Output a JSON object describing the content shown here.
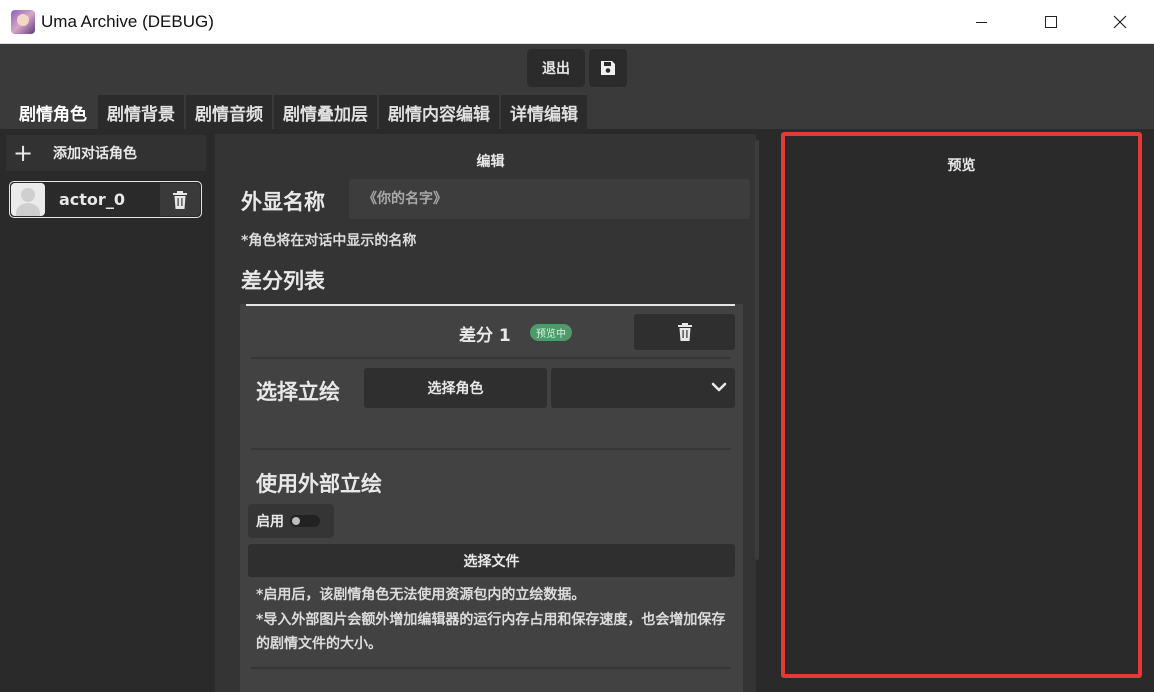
{
  "window": {
    "title": "Uma Archive (DEBUG)"
  },
  "toolbar": {
    "exit_label": "退出",
    "save_icon": "floppy-disk-icon"
  },
  "tabs": [
    {
      "label": "剧情角色",
      "active": true
    },
    {
      "label": "剧情背景"
    },
    {
      "label": "剧情音频"
    },
    {
      "label": "剧情叠加层"
    },
    {
      "label": "剧情内容编辑"
    },
    {
      "label": "详情编辑"
    }
  ],
  "sidebar": {
    "add_label": "添加对话角色",
    "actors": [
      {
        "name": "actor_0"
      }
    ]
  },
  "editor": {
    "title": "编辑",
    "display_name_label": "外显名称",
    "display_name_placeholder": "《你的名字》",
    "display_name_hint": "*角色将在对话中显示的名称",
    "diff_list_label": "差分列表",
    "diff": {
      "title": "差分 1",
      "badge": "预览中",
      "select_portrait_label": "选择立绘",
      "select_actor_button": "选择角色",
      "external_label": "使用外部立绘",
      "enable_label": "启用",
      "select_file_button": "选择文件",
      "note_1": "*启用后，该剧情角色无法使用资源包内的立绘数据。",
      "note_2": "*导入外部图片会额外增加编辑器的运行内存占用和保存速度，也会增加保存的剧情文件的大小。"
    }
  },
  "preview": {
    "title": "预览"
  },
  "colors": {
    "highlight": "#e53935",
    "badge": "#4e9a6a"
  }
}
